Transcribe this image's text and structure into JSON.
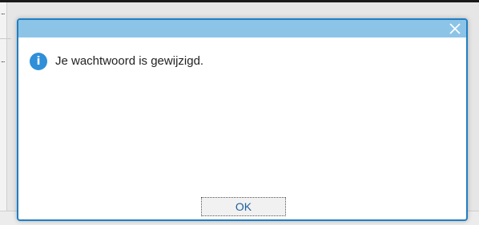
{
  "dialog": {
    "message": "Je wachtwoord is gewijzigd.",
    "ok_label": "OK",
    "info_icon": "i",
    "close_icon": "close-x"
  },
  "background": {
    "dots_1": "...",
    "dots_2": "..."
  },
  "colors": {
    "header": "#8cc4e8",
    "border": "#1f7fc4",
    "info_icon": "#2f8fd8",
    "ok_text": "#1c5fa0"
  }
}
